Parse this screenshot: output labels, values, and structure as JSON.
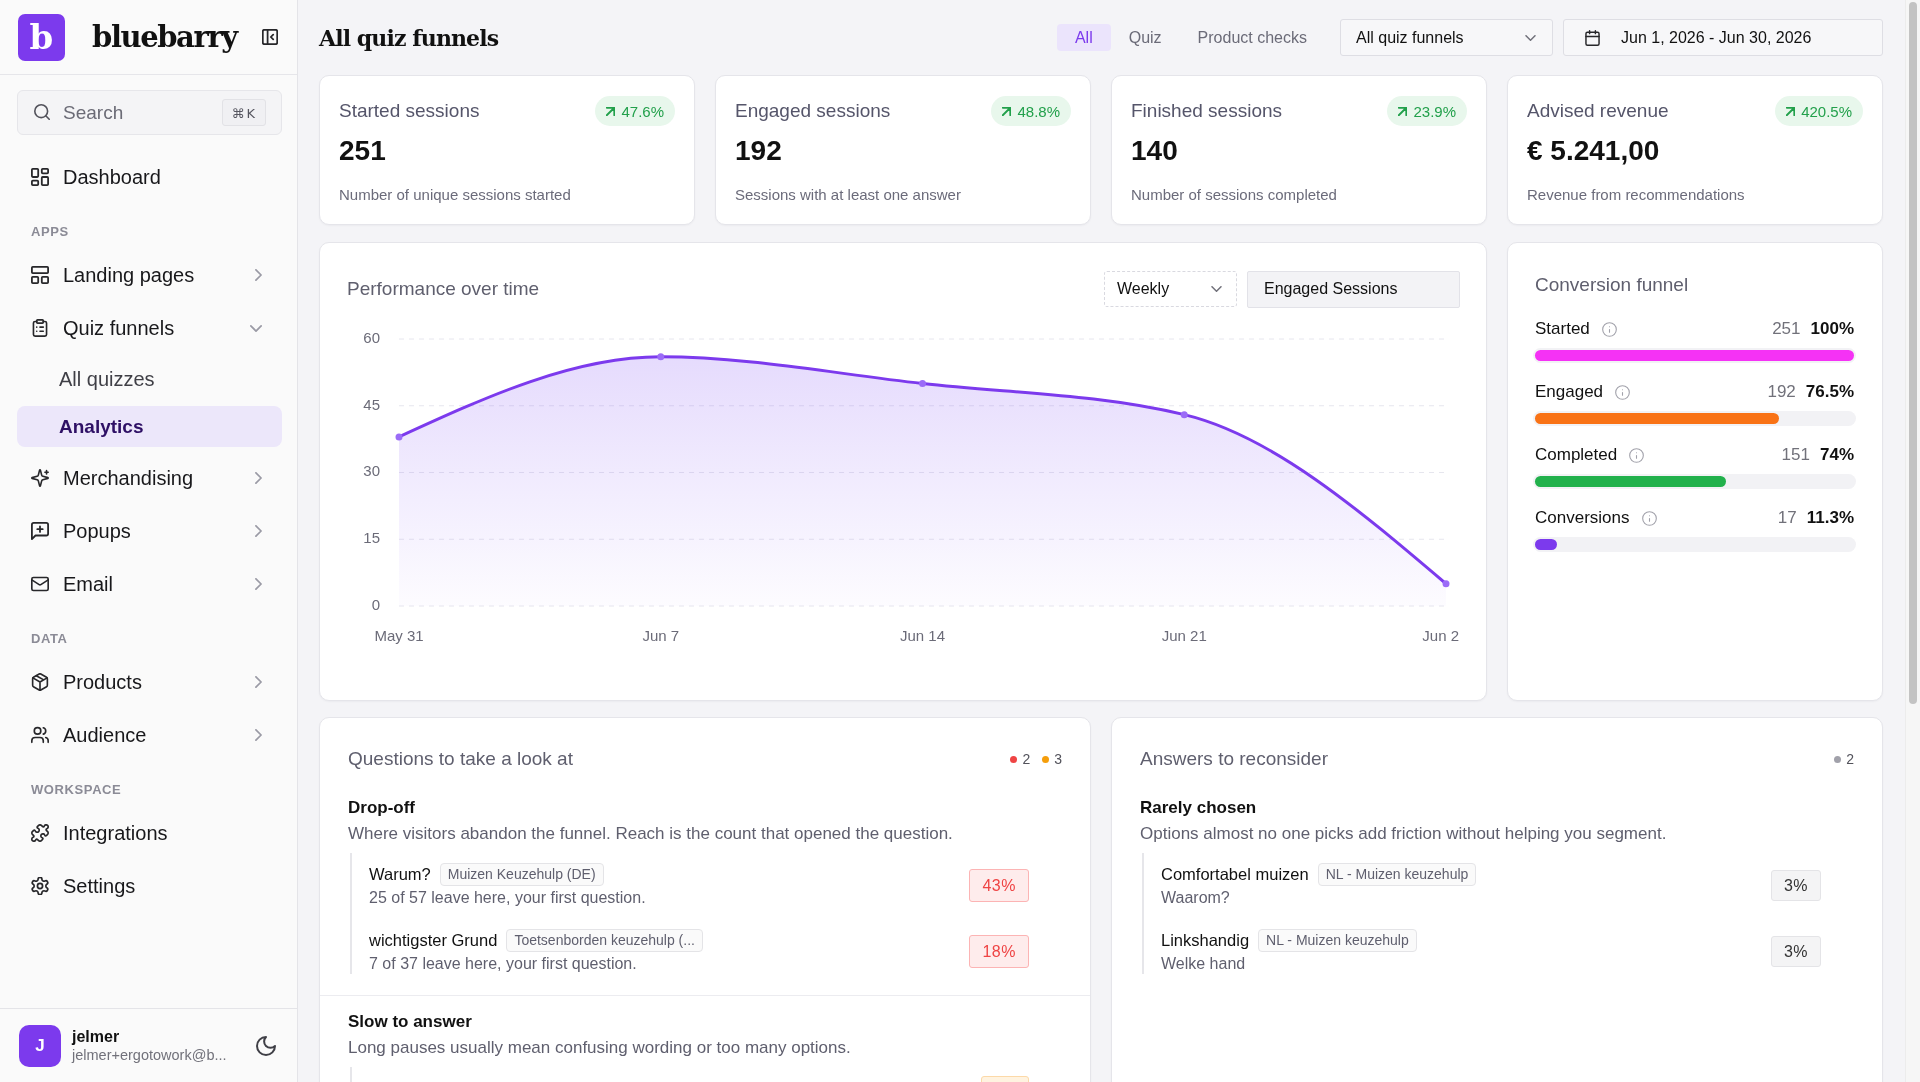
{
  "sidebar": {
    "logo_mark": "b",
    "brand": "bluebarry",
    "search": {
      "placeholder": "Search",
      "shortcut": "⌘K"
    },
    "nav": [
      {
        "kind": "link",
        "label": "Dashboard",
        "selected": false
      },
      {
        "kind": "heading",
        "label": "APPS"
      },
      {
        "kind": "group",
        "label": "Landing pages",
        "selected": false,
        "expanded": false
      },
      {
        "kind": "group",
        "label": "Quiz funnels",
        "selected": false,
        "expanded": true,
        "children": [
          {
            "label": "All quizzes",
            "selected": false
          },
          {
            "label": "Analytics",
            "selected": true
          }
        ]
      },
      {
        "kind": "group",
        "label": "Merchandising",
        "selected": false,
        "expanded": false
      },
      {
        "kind": "group",
        "label": "Popups",
        "selected": false,
        "expanded": false
      },
      {
        "kind": "group",
        "label": "Email",
        "selected": false,
        "expanded": false
      },
      {
        "kind": "heading",
        "label": "DATA"
      },
      {
        "kind": "group",
        "label": "Products",
        "selected": false,
        "expanded": false
      },
      {
        "kind": "group",
        "label": "Audience",
        "selected": false,
        "expanded": false
      },
      {
        "kind": "heading",
        "label": "WORKSPACE"
      },
      {
        "kind": "link",
        "label": "Integrations",
        "selected": false
      },
      {
        "kind": "link",
        "label": "Settings",
        "selected": false
      }
    ],
    "user": {
      "initial": "J",
      "name": "jelmer",
      "email": "jelmer+ergotowork@b..."
    }
  },
  "header": {
    "title": "All quiz funnels",
    "filters": [
      {
        "label": "All",
        "selected": true
      },
      {
        "label": "Quiz",
        "selected": false
      },
      {
        "label": "Product checks",
        "selected": false
      }
    ],
    "funnel_select": "All quiz funnels",
    "date_range": "Jun 1, 2026 - Jun 30, 2026"
  },
  "stats": [
    {
      "title": "Started sessions",
      "change": "47.6%",
      "positive": true,
      "value": "251",
      "description": "Number of unique sessions started"
    },
    {
      "title": "Engaged sessions",
      "change": "48.8%",
      "positive": true,
      "value": "192",
      "description": "Sessions with at least one answer"
    },
    {
      "title": "Finished sessions",
      "change": "23.9%",
      "positive": true,
      "value": "140",
      "description": "Number of sessions completed"
    },
    {
      "title": "Advised revenue",
      "change": "420.5%",
      "positive": true,
      "value": "€ 5.241,00",
      "description": "Revenue from recommendations"
    }
  ],
  "performance": {
    "title": "Performance over time",
    "period": "Weekly",
    "metric": "Engaged Sessions",
    "chart_data": {
      "type": "area",
      "categories": [
        "May 31",
        "Jun 7",
        "Jun 14",
        "Jun 21",
        "Jun 2"
      ],
      "values": [
        38,
        56,
        50,
        43,
        5
      ],
      "ylim": [
        0,
        60
      ],
      "yticks": [
        0,
        15,
        30,
        45,
        60
      ],
      "grid": true
    }
  },
  "funnel": {
    "title": "Conversion funnel",
    "steps": [
      {
        "label": "Started",
        "count": "251",
        "percent": "100%",
        "level": 1,
        "color": "#f532f5"
      },
      {
        "label": "Engaged",
        "count": "192",
        "percent": "76.5%",
        "level": 0.765,
        "color": "#f97316"
      },
      {
        "label": "Completed",
        "count": "151",
        "percent": "74%",
        "level": 0.6,
        "color": "#22b14c"
      },
      {
        "label": "Conversions",
        "count": "17",
        "percent": "11.3%",
        "level": 0.068,
        "color": "#7c3aed"
      }
    ]
  },
  "questions": {
    "title": "Questions to take a look at",
    "counts": [
      {
        "count": "2",
        "color": "#ef4444"
      },
      {
        "count": "3",
        "color": "#f59e0b"
      }
    ],
    "sections": [
      {
        "title": "Drop-off",
        "description": "Where visitors abandon the funnel. Reach is the count that opened the question.",
        "items": [
          {
            "kind": "danger",
            "name": "Warum?",
            "tag": "Muizen Keuzehulp (DE)",
            "detail": "25 of 57 leave here, your first question.",
            "value": "43%"
          },
          {
            "kind": "danger",
            "name": "wichtigster Grund",
            "tag": "Toetsenborden keuzehulp (...",
            "detail": "7 of 37 leave here, your first question.",
            "value": "18%"
          }
        ]
      },
      {
        "title": "Slow to answer",
        "description": "Long pauses usually mean confusing wording or too many options.",
        "items": [
          {
            "kind": "warning"
          }
        ]
      }
    ]
  },
  "answers": {
    "title": "Answers to reconsider",
    "counts": [
      {
        "count": "2",
        "color": "#a1a1aa"
      }
    ],
    "sections": [
      {
        "title": "Rarely chosen",
        "description": "Options almost no one picks add friction without helping you segment.",
        "items": [
          {
            "kind": "neutral",
            "name": "Comfortabel muizen",
            "tag": "NL - Muizen keuzehulp",
            "detail": "Waarom?",
            "value": "3%"
          },
          {
            "kind": "neutral",
            "name": "Linkshandig",
            "tag": "NL - Muizen keuzehulp",
            "detail": "Welke hand",
            "value": "3%"
          }
        ]
      }
    ]
  }
}
